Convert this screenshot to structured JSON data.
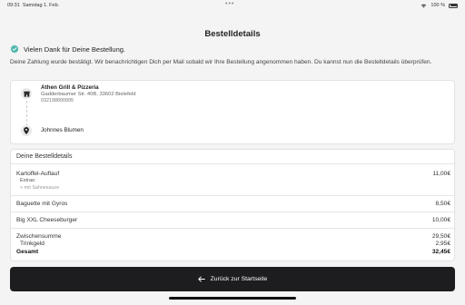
{
  "status": {
    "time": "09:31",
    "date": "Samstag 1. Feb.",
    "dots": "•••",
    "battery": "100 %"
  },
  "page": {
    "title": "Bestelldetails"
  },
  "thanks": {
    "text": "Vielen Dank für Deine Bestellung."
  },
  "info": {
    "text": "Deine Zahlung wurde bestätigt. Wir benachrichtigen Dich per Mail sobald wir Ihre Bestellung angenommen haben. Du kannst nun die Bestelldetails überprüfen."
  },
  "restaurant": {
    "name": "Athen Grill & Pizzeria",
    "address": "Gadderbaumer Str. 40B, 33602 Bielefeld",
    "phone": "032198890995"
  },
  "customer": {
    "name": "Johnnes Blumen"
  },
  "order": {
    "section_title": "Deine Bestelldetails",
    "items": [
      {
        "name": "Kartoffel-Auflauf",
        "price": "11,00€",
        "extras_label": "Extras:",
        "extras": "+ mit Sahnesauce"
      },
      {
        "name": "Baguette mit Gyros",
        "price": "8,50€"
      },
      {
        "name": "Big XXL Cheeseburger",
        "price": "10,00€"
      }
    ],
    "subtotal_label": "Zwischensumme",
    "subtotal": "29,50€",
    "tip_label": "Trinkgeld",
    "tip": "2,95€",
    "total_label": "Gesamt",
    "total": "32,45€"
  },
  "button": {
    "label": "Zurück zur Startseite"
  },
  "colors": {
    "accent_check": "#4db6ac",
    "button_bg": "#1d1d1f"
  },
  "icons": [
    "wifi-icon",
    "battery-icon",
    "check-badge-icon",
    "restaurant-icon",
    "location-pin-icon",
    "arrow-left-icon"
  ]
}
